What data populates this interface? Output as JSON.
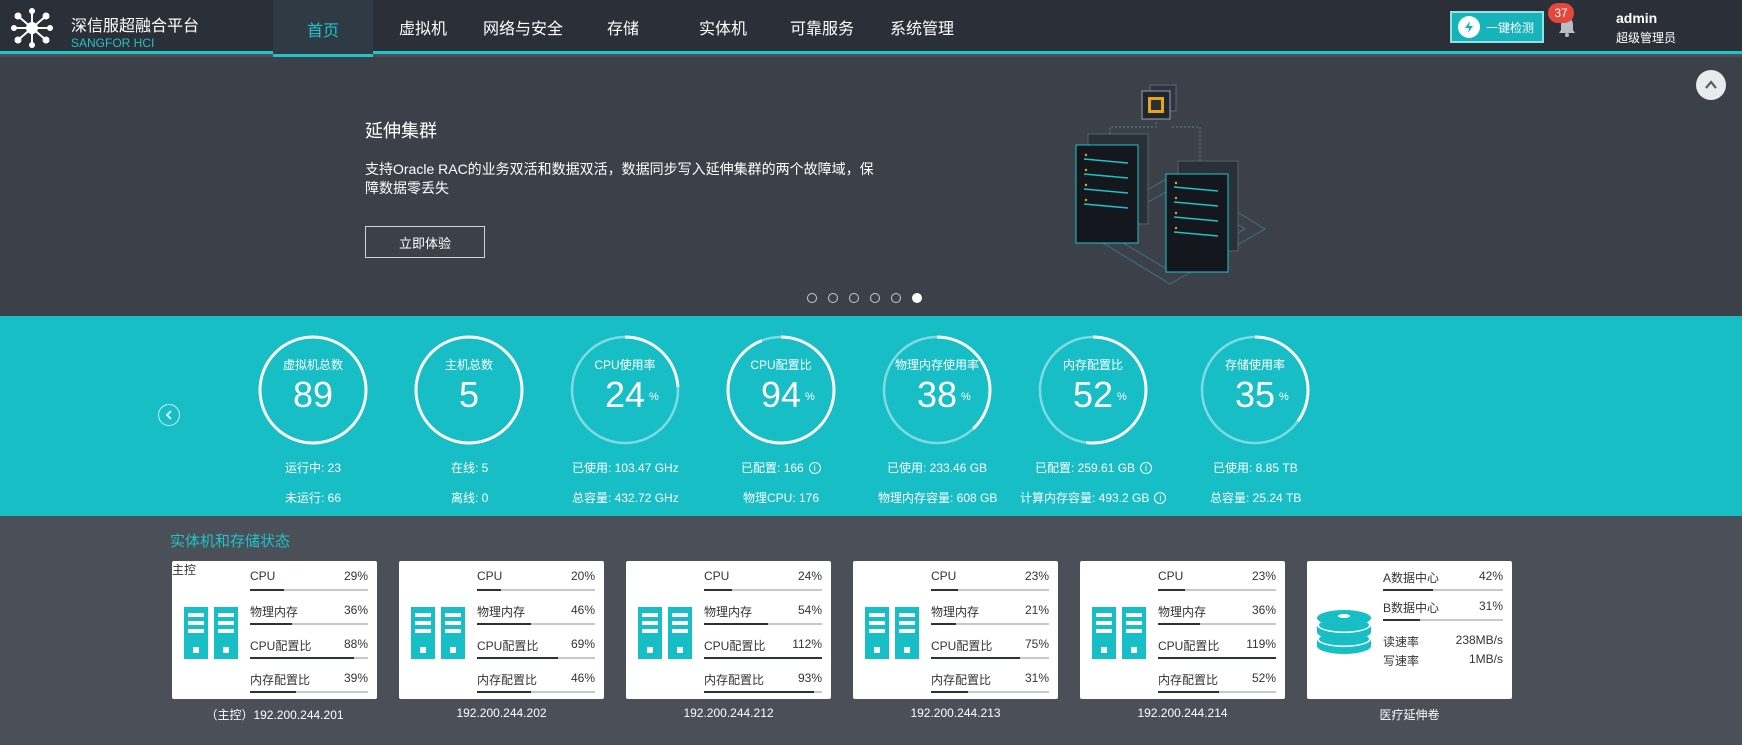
{
  "brand": {
    "name_cn": "深信服超融合平台",
    "name_en": "SANGFOR HCI"
  },
  "nav": [
    "首页",
    "虚拟机",
    "网络与安全",
    "存储",
    "实体机",
    "可靠服务",
    "系统管理"
  ],
  "header": {
    "check_label": "一键检测",
    "alerts": "37",
    "user": "admin",
    "role": "超级管理员"
  },
  "banner": {
    "title": "延伸集群",
    "desc": "支持Oracle RAC的业务双活和数据双活，数据同步写入延伸集群的两个故障域，保障数据零丢失",
    "button": "立即体验",
    "slides": 6,
    "active_slide": 6
  },
  "stats": [
    {
      "label": "虚拟机总数",
      "value": "89",
      "unit": "",
      "ring": 1.0,
      "row1": "运行中:   23",
      "row2": "未运行:   66"
    },
    {
      "label": "主机总数",
      "value": "5",
      "unit": "",
      "ring": 1.0,
      "row1": "在线:   5",
      "row2": "离线:   0"
    },
    {
      "label": "CPU使用率",
      "value": "24",
      "unit": "%",
      "ring": 0.24,
      "row1": "已使用:   103.47 GHz",
      "row2": "总容量:   432.72 GHz"
    },
    {
      "label": "CPU配置比",
      "value": "94",
      "unit": "%",
      "ring": 0.94,
      "row1": "已配置:   166",
      "row2": "物理CPU:   176",
      "info1": true
    },
    {
      "label": "物理内存使用率",
      "value": "38",
      "unit": "%",
      "ring": 0.38,
      "row1": "已使用:   233.46 GB",
      "row2": "物理内存容量:   608 GB"
    },
    {
      "label": "内存配置比",
      "value": "52",
      "unit": "%",
      "ring": 0.52,
      "row1": "已配置:   259.61 GB",
      "row2": "计算内存容量:   493.2 GB",
      "info1": true,
      "info2": true
    },
    {
      "label": "存储使用率",
      "value": "35",
      "unit": "%",
      "ring": 0.35,
      "row1": "已使用:   8.85 TB",
      "row2": "总容量:   25.24 TB"
    }
  ],
  "section_title": "实体机和存储状态",
  "hosts": [
    {
      "tag": "主控",
      "ip": "（主控）192.200.244.201",
      "metrics": [
        [
          "CPU",
          "29%",
          0.29
        ],
        [
          "物理内存",
          "36%",
          0.36
        ],
        [
          "CPU配置比",
          "88%",
          0.88
        ],
        [
          "内存配置比",
          "39%",
          0.39
        ]
      ]
    },
    {
      "tag": "",
      "ip": "192.200.244.202",
      "metrics": [
        [
          "CPU",
          "20%",
          0.2
        ],
        [
          "物理内存",
          "46%",
          0.46
        ],
        [
          "CPU配置比",
          "69%",
          0.69
        ],
        [
          "内存配置比",
          "46%",
          0.46
        ]
      ]
    },
    {
      "tag": "",
      "ip": "192.200.244.212",
      "metrics": [
        [
          "CPU",
          "24%",
          0.24
        ],
        [
          "物理内存",
          "54%",
          0.54
        ],
        [
          "CPU配置比",
          "112%",
          1.0
        ],
        [
          "内存配置比",
          "93%",
          0.93
        ]
      ]
    },
    {
      "tag": "",
      "ip": "192.200.244.213",
      "metrics": [
        [
          "CPU",
          "23%",
          0.23
        ],
        [
          "物理内存",
          "21%",
          0.21
        ],
        [
          "CPU配置比",
          "75%",
          0.75
        ],
        [
          "内存配置比",
          "31%",
          0.31
        ]
      ]
    },
    {
      "tag": "",
      "ip": "192.200.244.214",
      "metrics": [
        [
          "CPU",
          "23%",
          0.23
        ],
        [
          "物理内存",
          "36%",
          0.36
        ],
        [
          "CPU配置比",
          "119%",
          1.0
        ],
        [
          "内存配置比",
          "52%",
          0.52
        ]
      ]
    }
  ],
  "storage": {
    "name": "医疗延伸卷",
    "dc": [
      [
        "A数据中心",
        "42%",
        0.42
      ],
      [
        "B数据中心",
        "31%",
        0.31
      ]
    ],
    "io": [
      [
        "读速率",
        "238MB/s"
      ],
      [
        "写速率",
        "1MB/s"
      ]
    ]
  },
  "colors": {
    "accent": "#1fc3c8",
    "bar": "#2a3140",
    "badge": "#e5473d"
  }
}
